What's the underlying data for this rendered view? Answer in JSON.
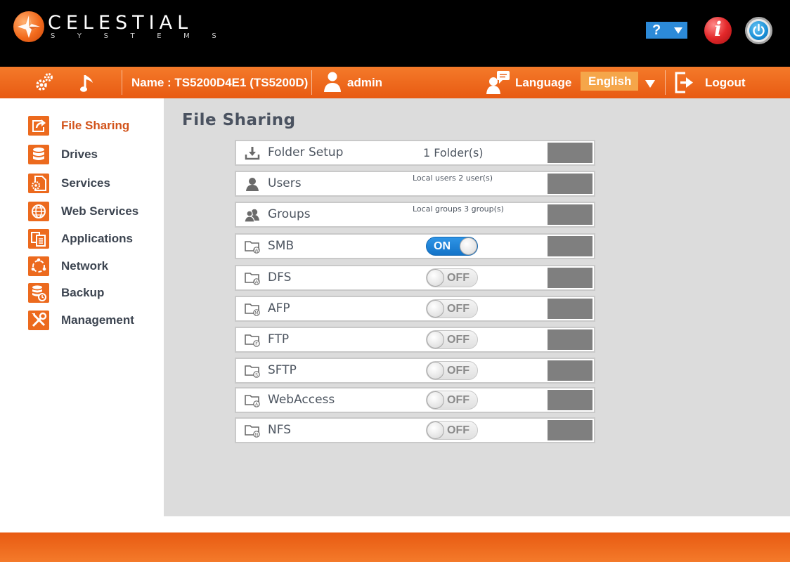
{
  "brand": {
    "name": "CELESTIAL",
    "tagline": "S Y S T E M S",
    "accent": "#EC6A1E",
    "logo_icon": "celestial-star-icon"
  },
  "header": {
    "help_label": "?",
    "info_label": "i",
    "power_icon": "power-icon"
  },
  "toolbar": {
    "settings_icon": "gears-icon",
    "media_icon": "music-note-icon",
    "device_name": "Name : TS5200D4E1 (TS5200D)",
    "user_icon": "user-icon",
    "user": "admin",
    "language_icon": "chat-user-icon",
    "language_label": "Language",
    "language_value": "English",
    "logout_icon": "logout-icon",
    "logout_label": "Logout"
  },
  "sidebar": {
    "items": [
      {
        "label": "File Sharing",
        "icon": "share-icon",
        "active": true
      },
      {
        "label": "Drives",
        "icon": "database-icon",
        "active": false
      },
      {
        "label": "Services",
        "icon": "services-icon",
        "active": false
      },
      {
        "label": "Web Services",
        "icon": "globe-icon",
        "active": false
      },
      {
        "label": "Applications",
        "icon": "applications-icon",
        "active": false
      },
      {
        "label": "Network",
        "icon": "network-icon",
        "active": false
      },
      {
        "label": "Backup",
        "icon": "backup-icon",
        "active": false
      },
      {
        "label": "Management",
        "icon": "tools-icon",
        "active": false
      }
    ]
  },
  "main": {
    "title": "File Sharing",
    "rows": [
      {
        "label": "Folder Setup",
        "icon": "download-icon",
        "value": "1 Folder(s)"
      },
      {
        "label": "Users",
        "icon": "user-icon",
        "note": "Local users 2 user(s)"
      },
      {
        "label": "Groups",
        "icon": "group-icon",
        "note": "Local groups 3 group(s)"
      },
      {
        "label": "SMB",
        "icon": "folder-w-icon",
        "toggle": "ON"
      },
      {
        "label": "DFS",
        "icon": "folder-w-icon",
        "toggle": "OFF"
      },
      {
        "label": "AFP",
        "icon": "folder-m-icon",
        "toggle": "OFF"
      },
      {
        "label": "FTP",
        "icon": "folder-f-icon",
        "toggle": "OFF"
      },
      {
        "label": "SFTP",
        "icon": "folder-s-icon",
        "toggle": "OFF"
      },
      {
        "label": "WebAccess",
        "icon": "folder-a-icon",
        "toggle": "OFF"
      },
      {
        "label": "NFS",
        "icon": "folder-n-icon",
        "toggle": "OFF"
      }
    ]
  }
}
